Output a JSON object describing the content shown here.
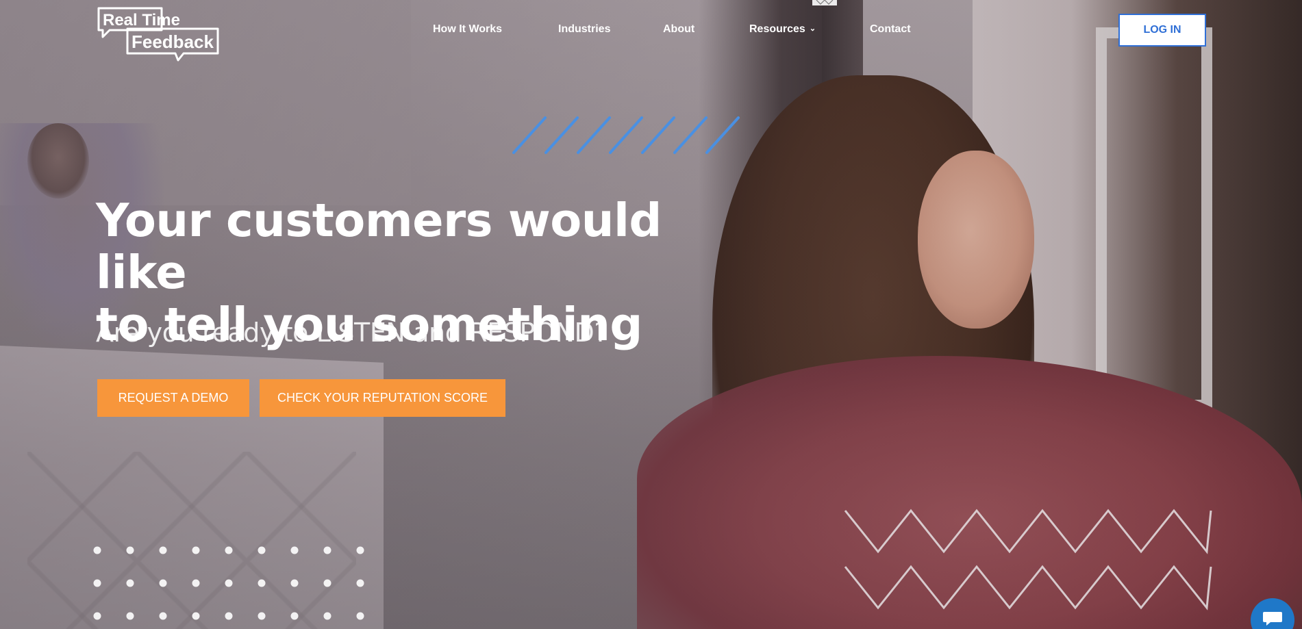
{
  "brand": {
    "logo_line1": "Real Time",
    "logo_line2": "Feedback",
    "logo_icon": "speech-bubble-logo-icon"
  },
  "nav": {
    "items": [
      {
        "label": "How It Works"
      },
      {
        "label": "Industries"
      },
      {
        "label": "About"
      },
      {
        "label": "Resources",
        "has_dropdown": true,
        "icon": "chevron-down-icon"
      },
      {
        "label": "Contact"
      }
    ],
    "login_label": "LOG IN"
  },
  "hero": {
    "headline_line1": "Your customers would like",
    "headline_line2": "to tell you something",
    "subheadline": "Are you ready to LISTEN and RESPOND?",
    "cta_primary": "REQUEST A DEMO",
    "cta_secondary": "CHECK YOUR REPUTATION SCORE"
  },
  "decorations": {
    "slashes_icon": "diagonal-stripes-icon",
    "dots_icon": "dot-grid-icon",
    "zigzag_icon": "zigzag-lines-icon"
  },
  "chat": {
    "icon": "chat-icon"
  },
  "colors": {
    "accent_orange": "#f7963b",
    "link_blue": "#2f6fd6",
    "stripe_blue": "#4a90e2",
    "chat_blue": "#1f78c8",
    "text_white": "#ffffff"
  }
}
